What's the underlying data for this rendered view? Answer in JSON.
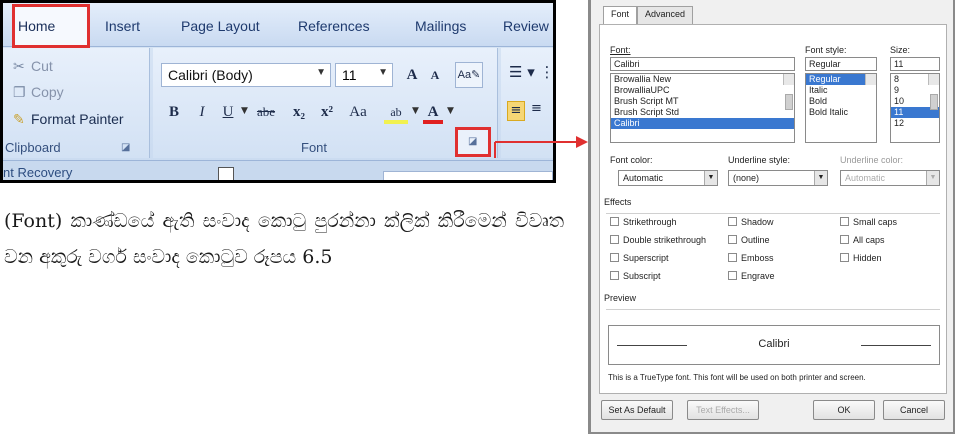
{
  "ribbon": {
    "tabs": [
      "Home",
      "Insert",
      "Page Layout",
      "References",
      "Mailings",
      "Review"
    ],
    "clipboard": {
      "cut": "Cut",
      "copy": "Copy",
      "format_painter": "Format Painter",
      "label": "Clipboard"
    },
    "font": {
      "font_name": "Calibri (Body)",
      "font_size": "11",
      "label": "Font",
      "grow": "A",
      "shrink": "A",
      "bold": "B",
      "italic": "I",
      "underline": "U",
      "strikethrough": "abe",
      "subscript": "x₂",
      "superscript": "x²",
      "change_case": "Aa",
      "highlight": "ab",
      "font_color": "A"
    },
    "recovery_text": "nt Recovery"
  },
  "caption": {
    "text": "(Font) කාණ්ඩයේ ඇති සංවාද කොටු පුරන්නා ක්ලික් කිරීමෙන් විවෘත වන අකුරු වර්ග සංවාද කොටුව රූපය 6.5"
  },
  "dialog": {
    "tabs": [
      "Font",
      "Advanced"
    ],
    "font_label": "Font:",
    "font_value": "Calibri",
    "font_list": [
      "Browallia New",
      "BrowalliaUPC",
      "Brush Script MT",
      "Brush Script Std",
      "Calibri"
    ],
    "style_label": "Font style:",
    "style_value": "Regular",
    "style_list": [
      "Regular",
      "Italic",
      "Bold",
      "Bold Italic"
    ],
    "size_label": "Size:",
    "size_value": "11",
    "size_list": [
      "8",
      "9",
      "10",
      "11",
      "12"
    ],
    "font_color_label": "Font color:",
    "font_color_value": "Automatic",
    "underline_style_label": "Underline style:",
    "underline_style_value": "(none)",
    "underline_color_label": "Underline color:",
    "underline_color_value": "Automatic",
    "effects_label": "Effects",
    "effects": [
      "Strikethrough",
      "Double strikethrough",
      "Superscript",
      "Subscript",
      "Shadow",
      "Outline",
      "Emboss",
      "Engrave",
      "Small caps",
      "All caps",
      "Hidden"
    ],
    "preview_label": "Preview",
    "preview_text": "Calibri",
    "truetype_note": "This is a TrueType font. This font will be used on both printer and screen.",
    "buttons": {
      "set_default": "Set As Default",
      "text_effects": "Text Effects...",
      "ok": "OK",
      "cancel": "Cancel"
    }
  },
  "colors": {
    "highlight_red": "#e03030",
    "ribbon_blue": "#c9daf0",
    "selection_blue": "#3a78d0"
  }
}
